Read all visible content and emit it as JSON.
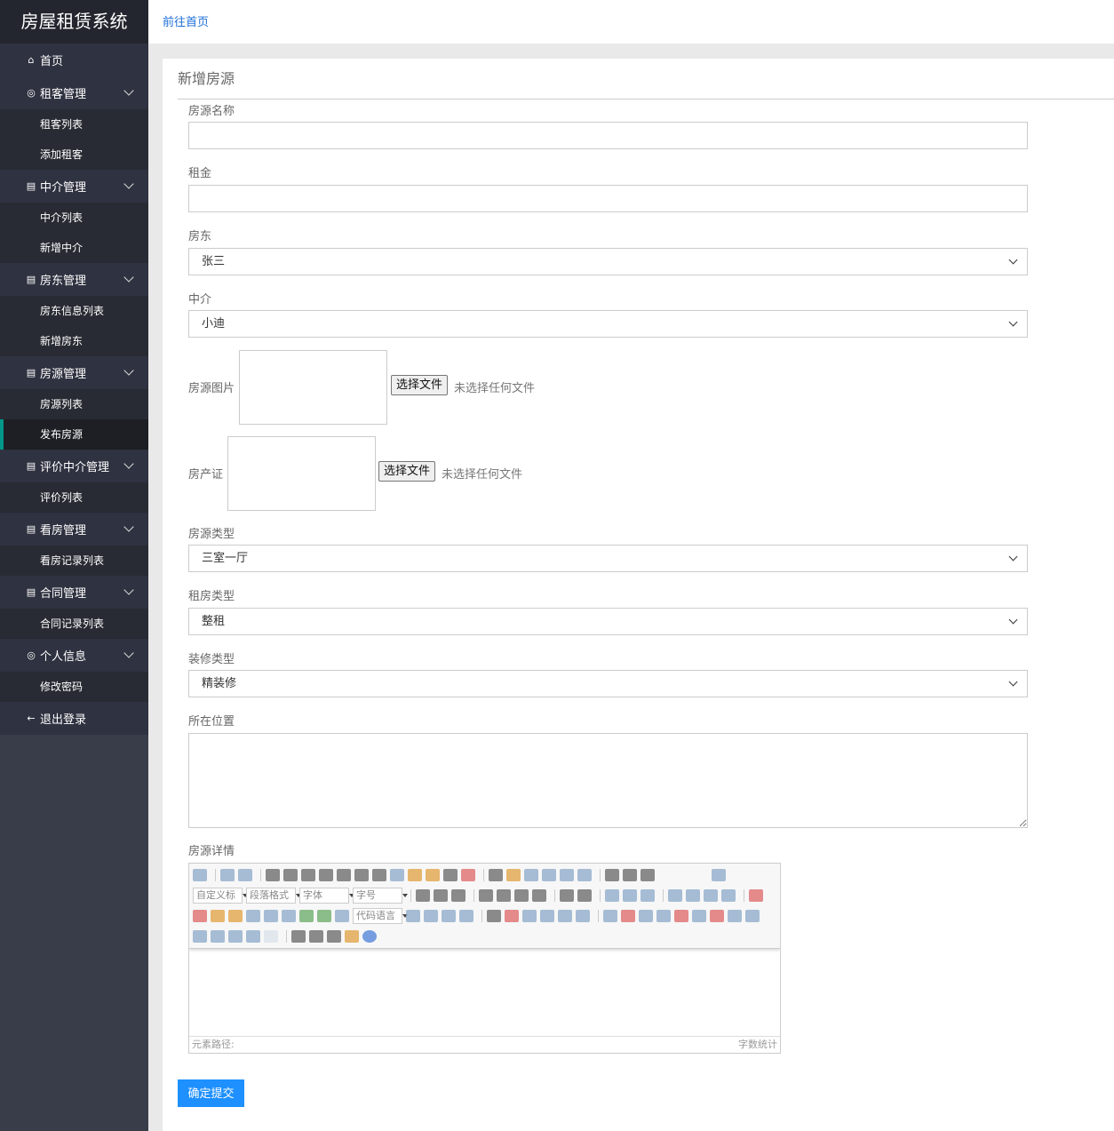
{
  "app": {
    "title": "房屋租赁系统"
  },
  "topbar": {
    "home_link": "前往首页"
  },
  "sidebar": {
    "home": "首页",
    "groups": [
      {
        "label": "租客管理",
        "items": [
          "租客列表",
          "添加租客"
        ]
      },
      {
        "label": "中介管理",
        "items": [
          "中介列表",
          "新增中介"
        ]
      },
      {
        "label": "房东管理",
        "items": [
          "房东信息列表",
          "新增房东"
        ]
      },
      {
        "label": "房源管理",
        "items": [
          "房源列表",
          "发布房源"
        ]
      },
      {
        "label": "评价中介管理",
        "items": [
          "评价列表"
        ]
      },
      {
        "label": "看房管理",
        "items": [
          "看房记录列表"
        ]
      },
      {
        "label": "合同管理",
        "items": [
          "合同记录列表"
        ]
      },
      {
        "label": "个人信息",
        "items": [
          "修改密码"
        ]
      }
    ],
    "logout": "退出登录",
    "active_item": "发布房源"
  },
  "form": {
    "title": "新增房源",
    "name_label": "房源名称",
    "name_value": "",
    "rent_label": "租金",
    "rent_value": "",
    "landlord_label": "房东",
    "landlord_value": "张三",
    "agent_label": "中介",
    "agent_value": "小迪",
    "image_label": "房源图片",
    "cert_label": "房产证",
    "file_button": "选择文件",
    "file_none": "未选择任何文件",
    "house_type_label": "房源类型",
    "house_type_value": "三室一厅",
    "rent_type_label": "租房类型",
    "rent_type_value": "整租",
    "decor_label": "装修类型",
    "decor_value": "精装修",
    "location_label": "所在位置",
    "detail_label": "房源详情",
    "submit": "确定提交"
  },
  "editor": {
    "custom_title": "自定义标",
    "paragraph": "段落格式",
    "font": "字体",
    "font_size": "字号",
    "code_lang": "代码语言",
    "path_label": "元素路径:",
    "word_count": "字数统计"
  },
  "colors": {
    "accent": "#009688",
    "button": "#1e90ff",
    "sidebar": "#393d49"
  }
}
